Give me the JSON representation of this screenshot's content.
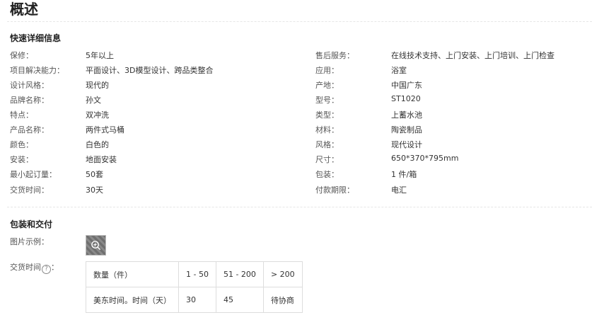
{
  "page": {
    "title": "概述"
  },
  "quick_details": {
    "heading": "快速详细信息",
    "left": [
      {
        "label": "保修：",
        "value": "5年以上"
      },
      {
        "label": "项目解决能力：",
        "value": "平面设计、3D模型设计、跨品类整合"
      },
      {
        "label": "设计风格：",
        "value": "现代的"
      },
      {
        "label": "品牌名称：",
        "value": "孙文"
      },
      {
        "label": "特点：",
        "value": "双冲洗"
      },
      {
        "label": "产品名称：",
        "value": "两件式马桶"
      },
      {
        "label": "颜色：",
        "value": "白色的"
      },
      {
        "label": "安装：",
        "value": "地面安装"
      },
      {
        "label": "最小起订量：",
        "value": "50套"
      },
      {
        "label": "交货时间：",
        "value": "30天"
      }
    ],
    "right": [
      {
        "label": "售后服务：",
        "value": "在线技术支持、上门安装、上门培训、上门检查"
      },
      {
        "label": "应用：",
        "value": "浴室"
      },
      {
        "label": "产地：",
        "value": "中国广东"
      },
      {
        "label": "型号：",
        "value": "ST1020"
      },
      {
        "label": "类型：",
        "value": "上蓄水池"
      },
      {
        "label": "材料：",
        "value": "陶瓷制品"
      },
      {
        "label": "风格：",
        "value": "现代设计"
      },
      {
        "label": "尺寸：",
        "value": "650*370*795mm"
      },
      {
        "label": "包装：",
        "value": "1 件/箱"
      },
      {
        "label": "付款期限：",
        "value": "电汇"
      }
    ]
  },
  "packaging": {
    "heading": "包装和交付",
    "image_label": "图片示例：",
    "lead_time_label": "交货时间",
    "help_glyph": "?",
    "lead_table": {
      "header": [
        "数量（件）",
        "1 - 50",
        "51 - 200",
        "> 200"
      ],
      "row": [
        "美东时间。时间（天）",
        "30",
        "45",
        "待协商"
      ]
    }
  }
}
